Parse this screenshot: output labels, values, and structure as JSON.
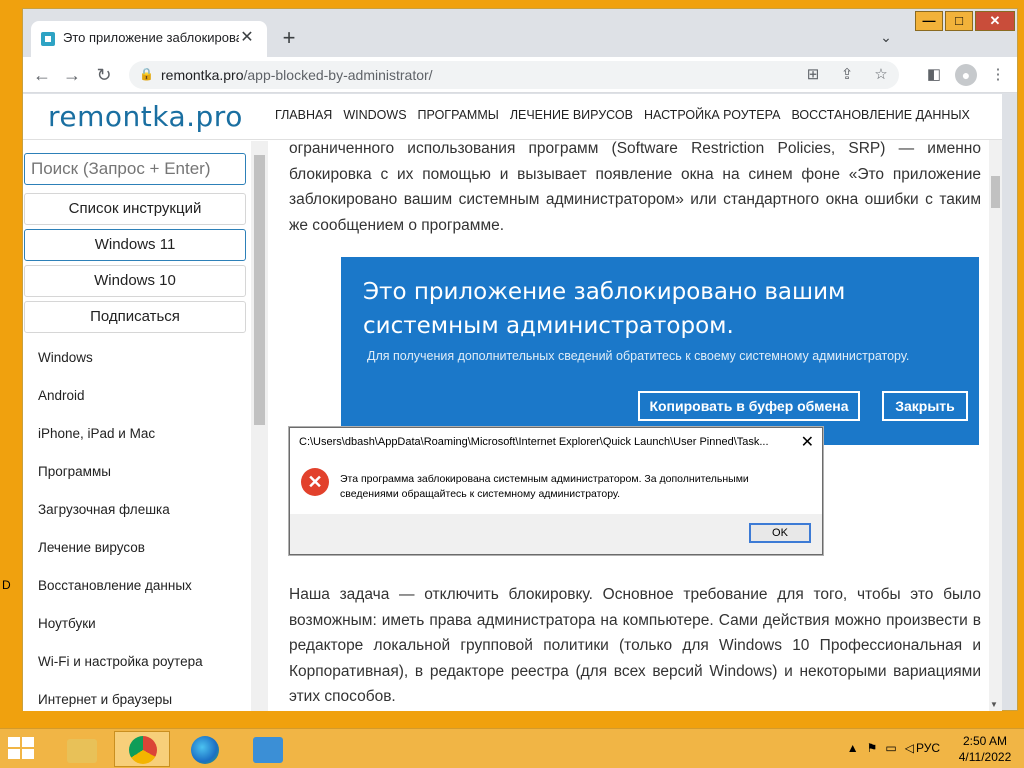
{
  "desktop": {
    "edge_glyph": "D"
  },
  "browser": {
    "tab": {
      "title": "Это приложение заблокирован",
      "close": "✕"
    },
    "new_tab": "+",
    "tab_search": "⌄",
    "window_buttons": {
      "minimize": "—",
      "maximize": "□",
      "close": "✕"
    },
    "nav": {
      "back": "←",
      "forward": "→",
      "reload": "↻"
    },
    "url_host": "remontka.pro",
    "url_path": "/app-blocked-by-administrator/",
    "omni_icons": {
      "translate": "⊞",
      "share": "⇪",
      "bookmark": "☆"
    },
    "right_icons": {
      "side_panel": "◧",
      "profile": "●",
      "menu": "⋮"
    }
  },
  "site": {
    "logo": "remontka.pro",
    "nav": [
      "ГЛАВНАЯ",
      "WINDOWS",
      "ПРОГРАММЫ",
      "ЛЕЧЕНИЕ ВИРУСОВ",
      "НАСТРОЙКА РОУТЕРА",
      "ВОССТАНОВЛЕНИЕ ДАННЫХ"
    ]
  },
  "sidebar": {
    "search_placeholder": "Поиск (Запрос + Enter)",
    "buttons": [
      "Список инструкций",
      "Windows 11",
      "Windows 10",
      "Подписаться"
    ],
    "links": [
      "Windows",
      "Android",
      "iPhone, iPad и Mac",
      "Программы",
      "Загрузочная флешка",
      "Лечение вирусов",
      "Восстановление данных",
      "Ноутбуки",
      "Wi-Fi и настройка роутера",
      "Интернет и браузеры"
    ]
  },
  "content": {
    "para1": "ограниченного использования программ (Software Restriction Policies, SRP) — именно блокировка с их помощью и вызывает появление окна на синем фоне «Это приложение заблокировано вашим системным администратором» или стандартного окна ошибки с таким же сообщением о программе.",
    "blue_title": "Это приложение заблокировано вашим системным администратором.",
    "blue_sub": "Для получения дополнительных сведений обратитесь к своему системному администратору.",
    "blue_copy_btn": "Копировать в буфер обмена",
    "blue_close_btn": "Закрыть",
    "dialog_title": "C:\\Users\\dbash\\AppData\\Roaming\\Microsoft\\Internet Explorer\\Quick Launch\\User Pinned\\Task...",
    "dialog_close": "✕",
    "dialog_icon": "✕",
    "dialog_message": "Эта программа заблокирована системным администратором. За дополнительными сведениями обращайтесь к системному администратору.",
    "dialog_ok": "OK",
    "para2": "Наша задача — отключить блокировку. Основное требование для того, чтобы это было возможным: иметь права администратора на компьютере. Сами действия можно произвести в редакторе локальной групповой политики (только для Windows 10 Профессиональная и Корпоративная), в редакторе реестра (для всех версий Windows) и некоторыми вариациями этих способов."
  },
  "taskbar": {
    "tray_icons": {
      "up": "▲",
      "flag": "⚑",
      "network": "▭",
      "volume": "◁"
    },
    "lang": "РУС",
    "time": "2:50 AM",
    "date": "4/11/2022"
  },
  "colors": {
    "desktop": "#f0a10e",
    "accent_blue": "#1b78c9",
    "logo": "#1a6fa1",
    "error_red": "#e2412c"
  }
}
